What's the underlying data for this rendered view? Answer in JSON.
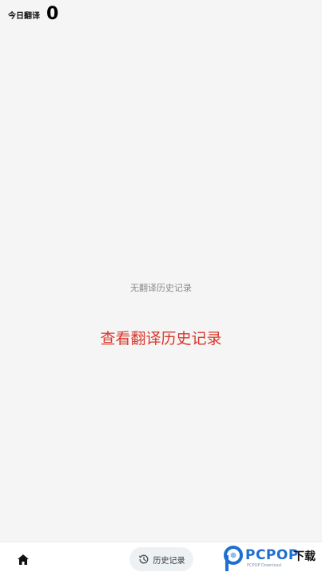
{
  "header": {
    "label": "今日翻译",
    "count": "0"
  },
  "main": {
    "empty_text": "无翻译历史记录",
    "history_link": "查看翻译历史记录"
  },
  "bottom_nav": {
    "home_icon": "home-icon",
    "history_label": "历史记录",
    "history_icon": "history-clock-icon"
  },
  "watermark": {
    "brand": "PCPOP",
    "suffix": "下载",
    "small": "PCPOP Download"
  },
  "colors": {
    "background": "#f5f5f5",
    "link_red": "#d9372b",
    "empty_gray": "#8a8a8a",
    "brand_blue": "#1d6fd1"
  }
}
